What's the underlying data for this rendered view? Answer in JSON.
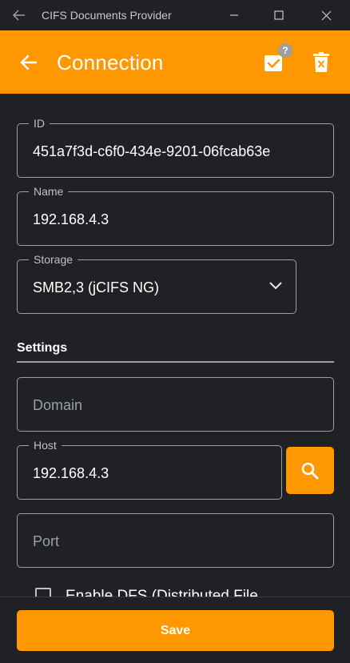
{
  "window": {
    "title": "CIFS Documents Provider"
  },
  "appbar": {
    "title": "Connection",
    "help_badge": "?"
  },
  "fields": {
    "id": {
      "label": "ID",
      "value": "451a7f3d-c6f0-434e-9201-06fcab63e"
    },
    "name": {
      "label": "Name",
      "value": "192.168.4.3"
    },
    "storage": {
      "label": "Storage",
      "value": "SMB2,3 (jCIFS NG)"
    }
  },
  "settings": {
    "heading": "Settings",
    "domain": {
      "placeholder": "Domain"
    },
    "host": {
      "label": "Host",
      "value": "192.168.4.3"
    },
    "port": {
      "placeholder": "Port"
    },
    "dfs": {
      "label": "Enable DFS (Distributed File",
      "checked": false
    }
  },
  "footer": {
    "save_label": "Save"
  },
  "colors": {
    "accent": "#ff9800",
    "background": "#202124",
    "outline": "#9aa0a6"
  }
}
